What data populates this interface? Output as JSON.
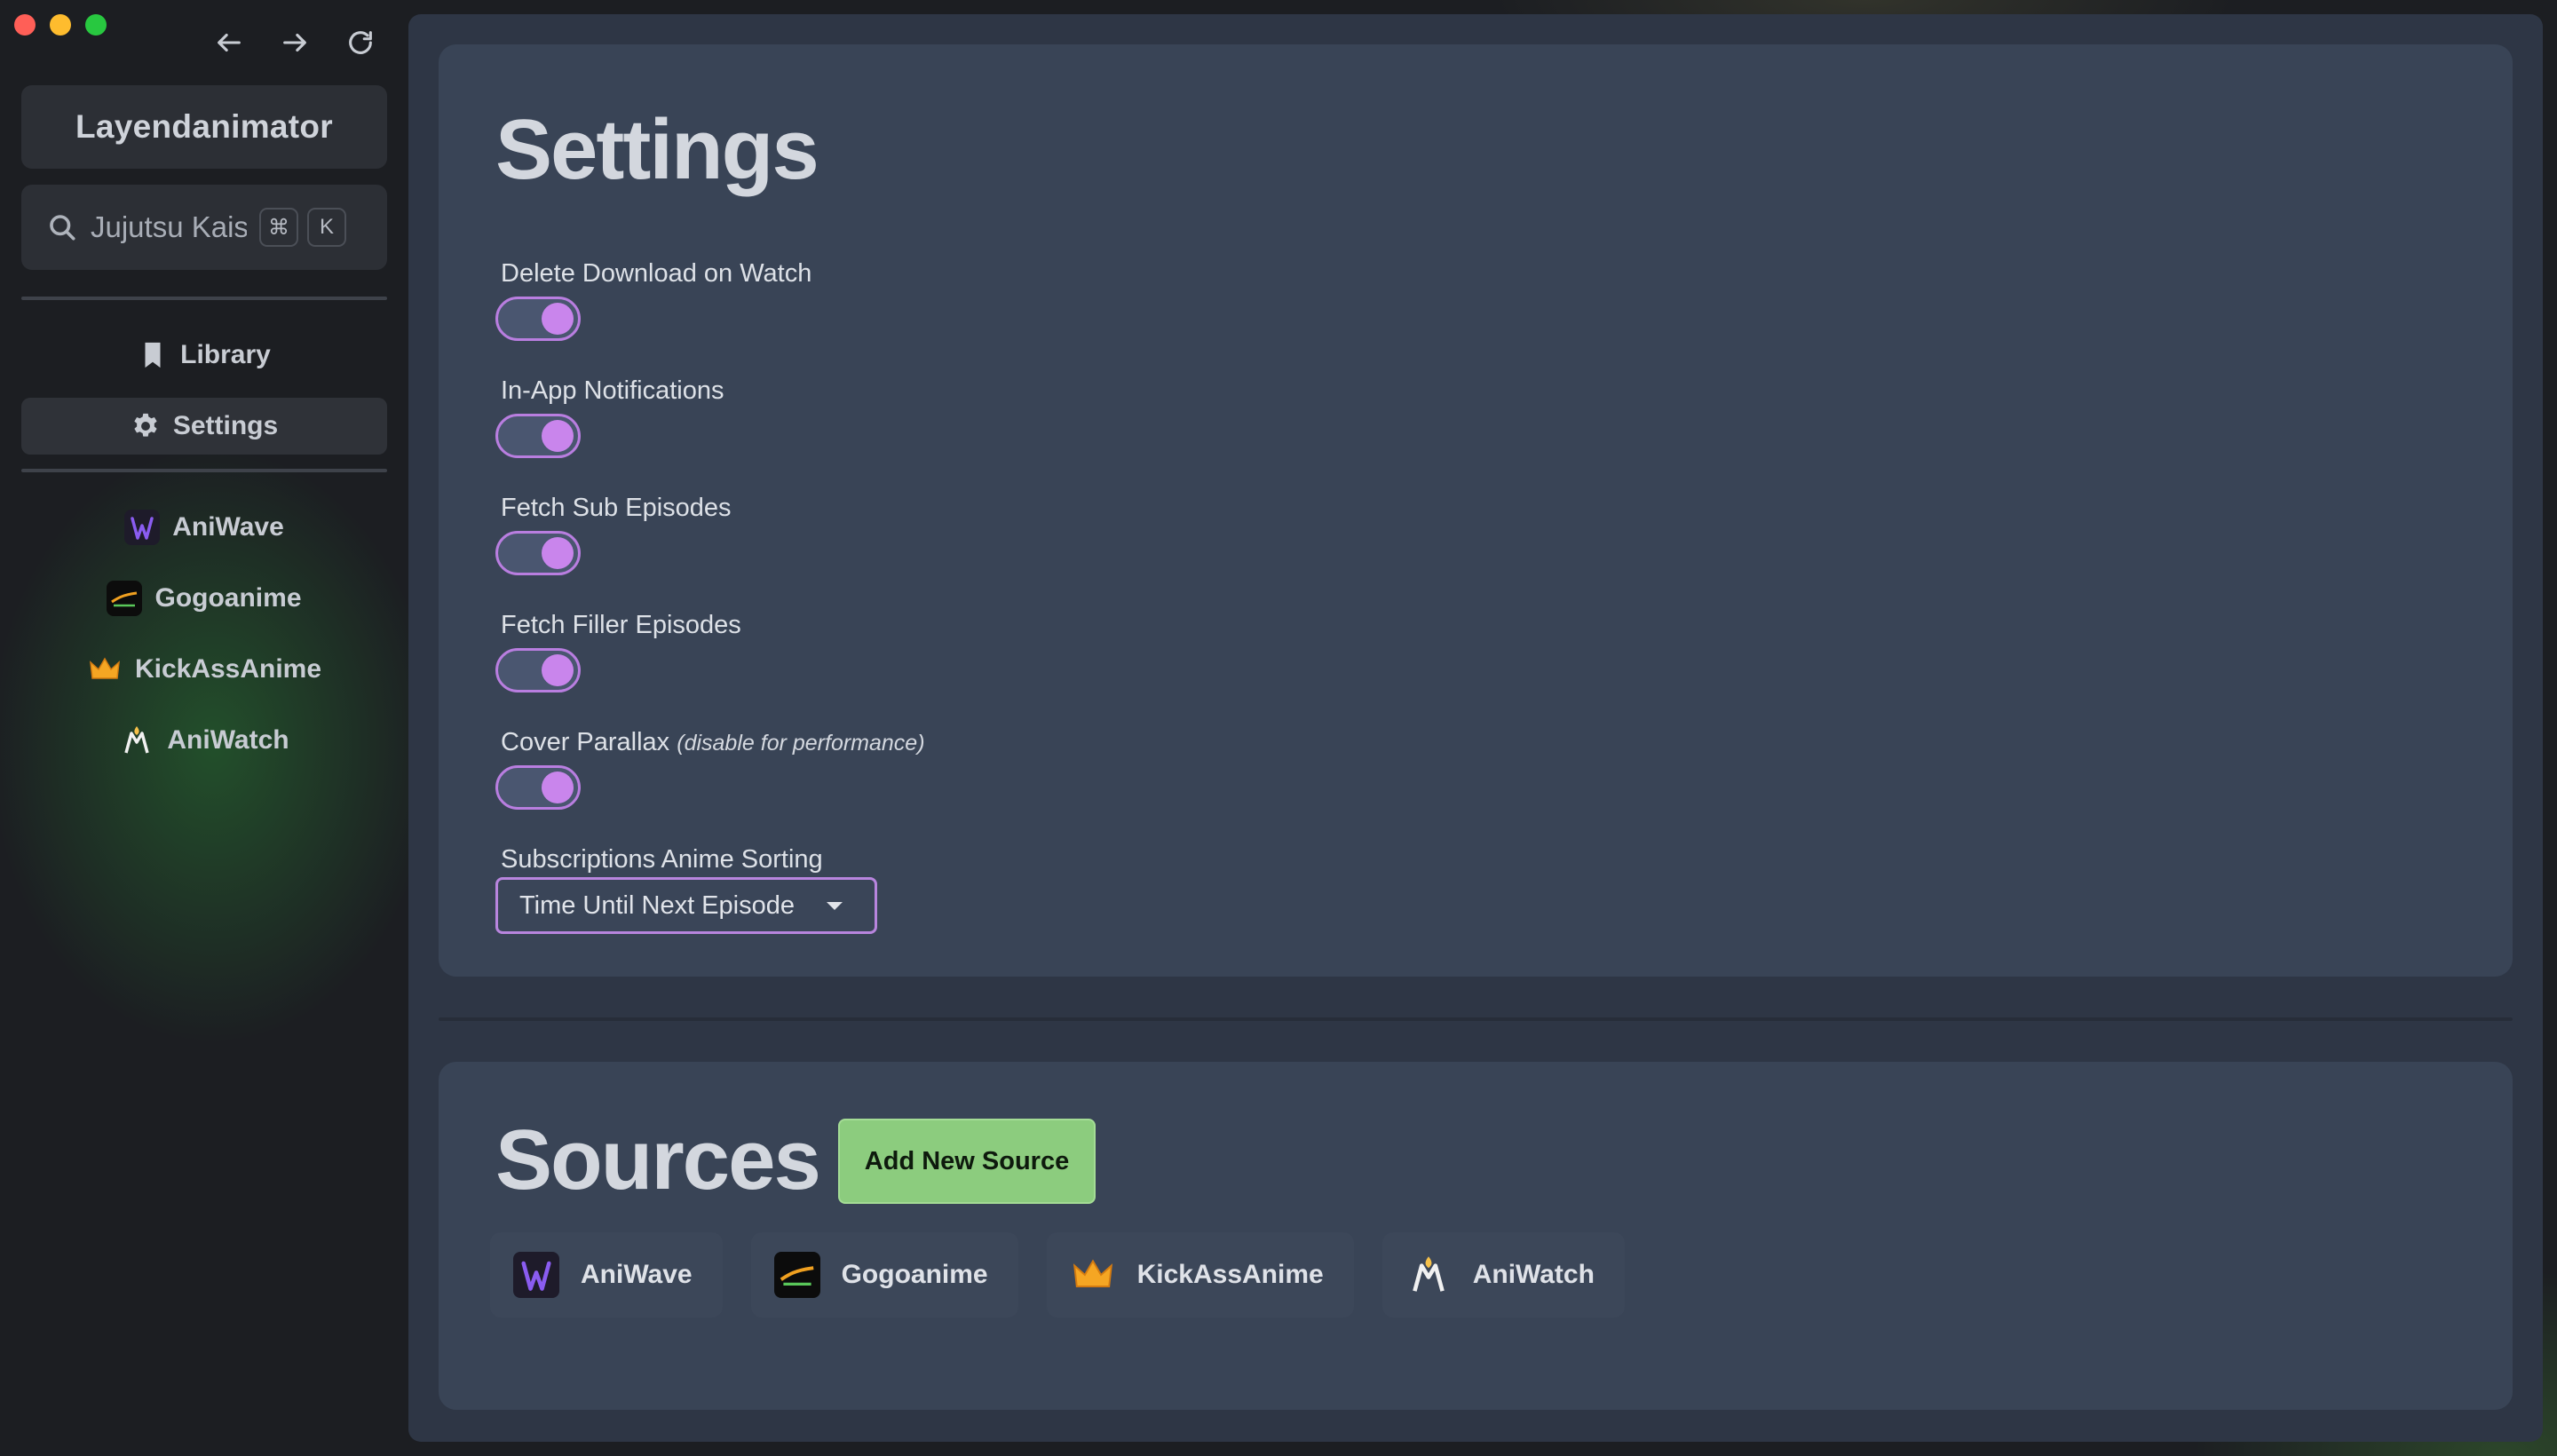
{
  "app": {
    "title": "Layendanimator"
  },
  "search": {
    "value": "Jujutsu Kaisen",
    "shortcut_mod": "⌘",
    "shortcut_key": "K"
  },
  "nav": {
    "items": [
      {
        "label": "Library",
        "icon": "bookmark-icon"
      },
      {
        "label": "Settings",
        "icon": "gear-icon"
      }
    ]
  },
  "sidebar_sources": [
    {
      "label": "AniWave",
      "icon": "aniwave-logo"
    },
    {
      "label": "Gogoanime",
      "icon": "gogoanime-logo"
    },
    {
      "label": "KickAssAnime",
      "icon": "crown-icon"
    },
    {
      "label": "AniWatch",
      "icon": "aniwatch-logo"
    }
  ],
  "settings": {
    "title": "Settings",
    "toggles": [
      {
        "label": "Delete Download on Watch",
        "on": true
      },
      {
        "label": "In-App Notifications",
        "on": true
      },
      {
        "label": "Fetch Sub Episodes",
        "on": true
      },
      {
        "label": "Fetch Filler Episodes",
        "on": true
      },
      {
        "label": "Cover Parallax",
        "note": "(disable for performance)",
        "on": true
      }
    ],
    "sorting": {
      "label": "Subscriptions Anime Sorting",
      "value": "Time Until Next Episode"
    }
  },
  "sources": {
    "title": "Sources",
    "add_label": "Add New Source",
    "items": [
      {
        "label": "AniWave"
      },
      {
        "label": "Gogoanime"
      },
      {
        "label": "KickAssAnime"
      },
      {
        "label": "AniWatch"
      }
    ]
  },
  "colors": {
    "accent": "#c985ec",
    "add_button": "#8ccc7e",
    "panel": "#394456"
  }
}
